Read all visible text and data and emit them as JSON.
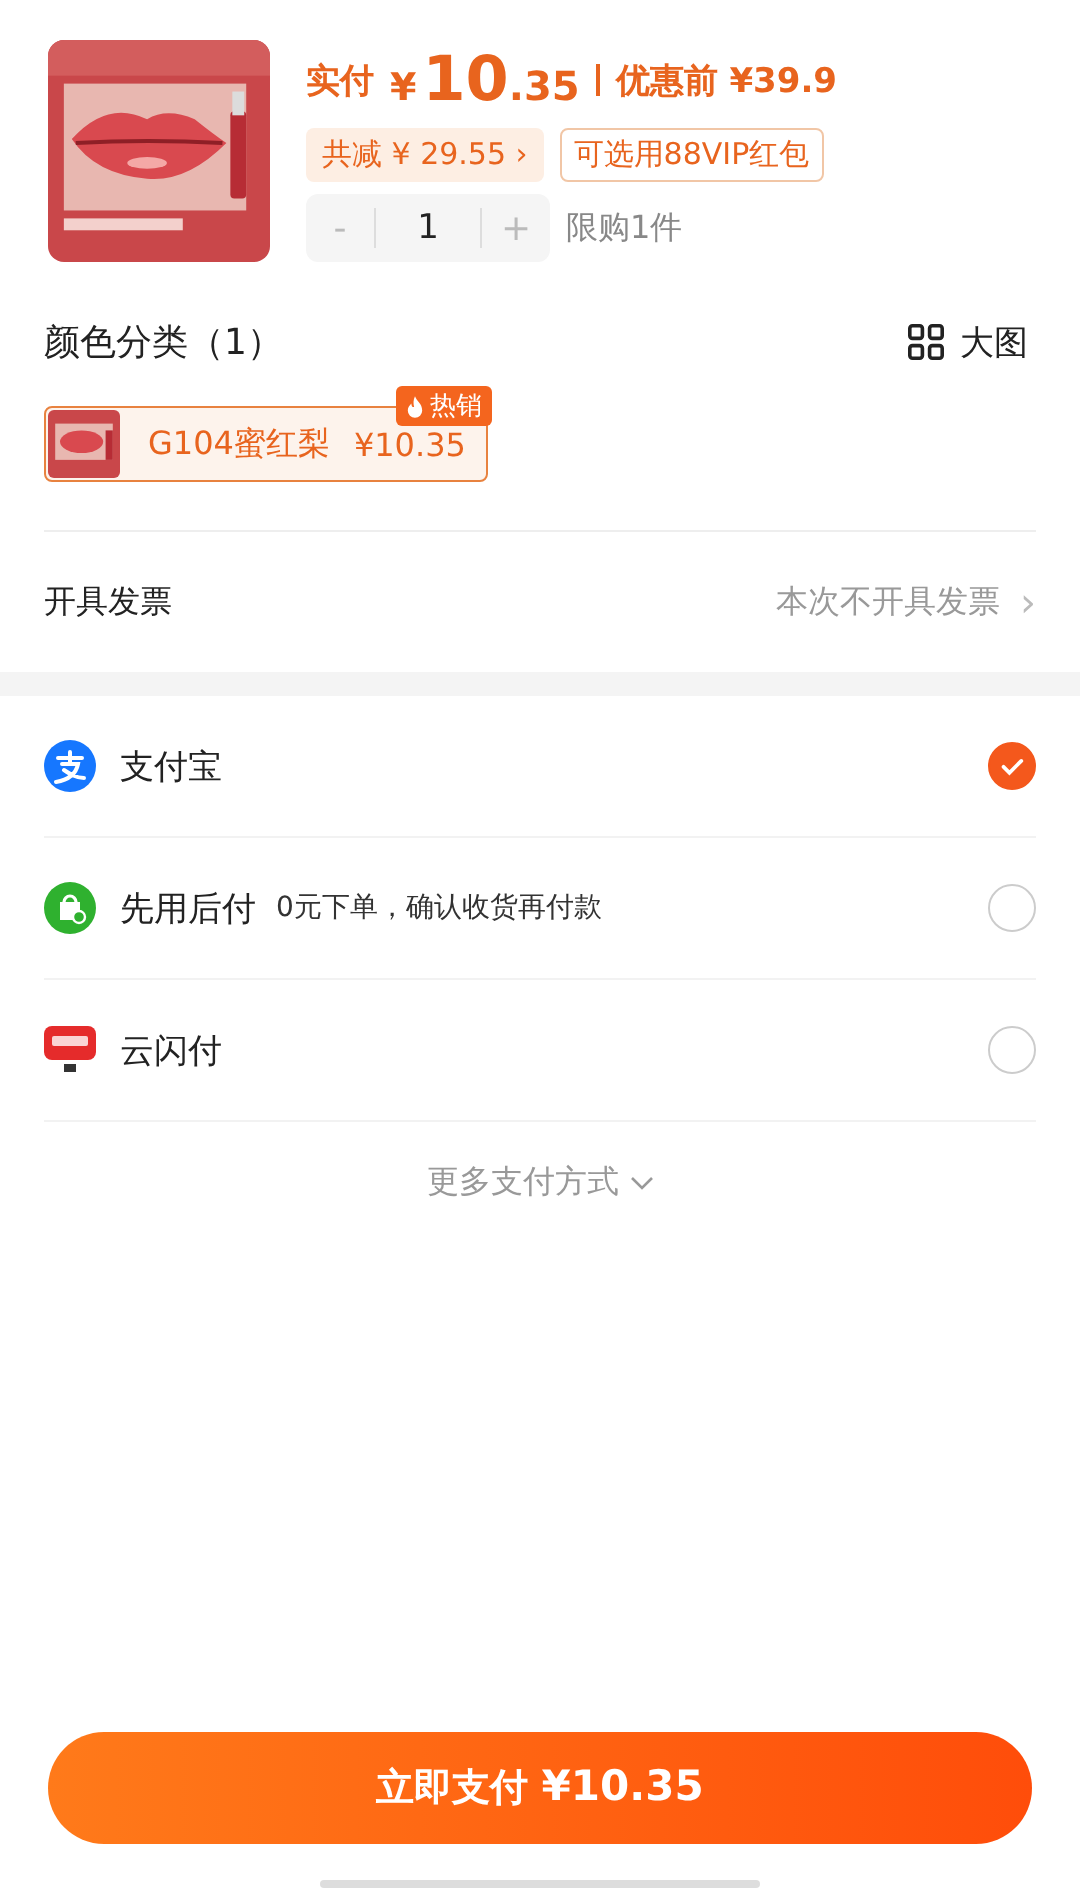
{
  "product": {
    "price_label": "实付",
    "currency": "¥",
    "price_int": "10",
    "price_dec": ".35",
    "original_label": "优惠前 ¥39.9",
    "discount": "共减 ¥ 29.55",
    "discount_arrow": "›",
    "coupon": "可选用88VIP红包",
    "minus": "-",
    "quantity": "1",
    "plus": "+",
    "limit": "限购1件"
  },
  "color_section": {
    "title": "颜色分类（1）",
    "view_label": "大图",
    "options": [
      {
        "name": "G104蜜红梨",
        "price": "¥10.35",
        "badge": "热销",
        "selected": true
      }
    ]
  },
  "invoice": {
    "label": "开具发票",
    "value": "本次不开具发票",
    "arrow": "›"
  },
  "payments": [
    {
      "kind": "alipay",
      "name": "支付宝",
      "selected": true
    },
    {
      "kind": "later",
      "name": "先用后付",
      "note": "0元下单，确认收货再付款",
      "selected": false
    },
    {
      "kind": "unionpay",
      "name": "云闪付",
      "selected": false
    }
  ],
  "more_label": "更多支付方式",
  "pay_button": {
    "label": "立即支付",
    "amount": "¥10.35"
  }
}
